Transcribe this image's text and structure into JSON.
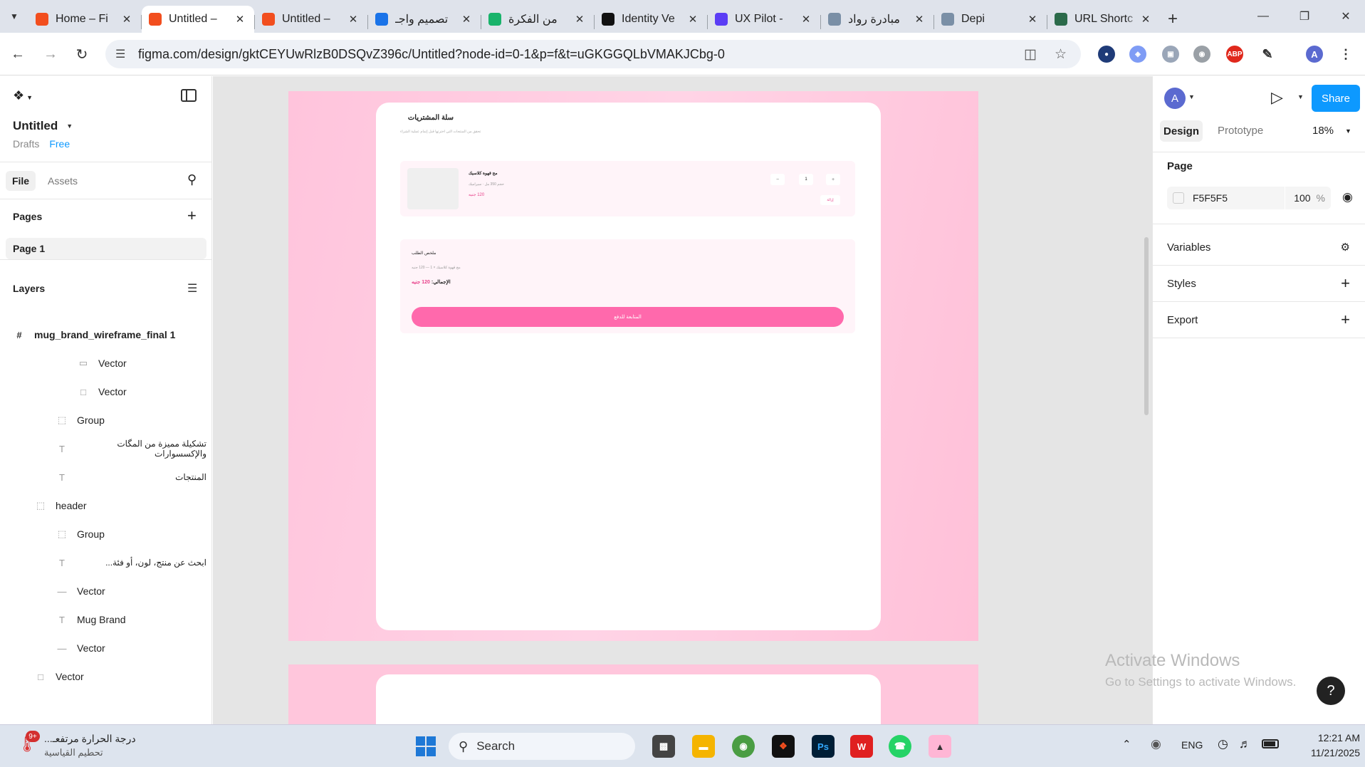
{
  "browser": {
    "tabs": [
      {
        "title": "Home – Fi",
        "favicon": "figma-icon",
        "color": "#f24e1e"
      },
      {
        "title": "Untitled –",
        "favicon": "figma-icon",
        "color": "#f24e1e",
        "active": true
      },
      {
        "title": "Untitled –",
        "favicon": "figma-icon",
        "color": "#f24e1e"
      },
      {
        "title": "تصميم واجـ",
        "favicon": "swirl-icon",
        "color": "#1a73e8"
      },
      {
        "title": "من الفكرة",
        "favicon": "k-logo-icon",
        "color": "#19b36b"
      },
      {
        "title": "Identity Ve",
        "favicon": "upwork-icon",
        "color": "#111111"
      },
      {
        "title": "UX Pilot - ",
        "favicon": "ux-logo-icon",
        "color": "#5b3df5"
      },
      {
        "title": "مبادرة رواد",
        "favicon": "person-icon",
        "color": "#7a8fa6"
      },
      {
        "title": "Depi",
        "favicon": "person-icon",
        "color": "#7a8fa6"
      },
      {
        "title": "URL Shortc",
        "favicon": "link-icon",
        "color": "#2b6a4a"
      }
    ],
    "url": "figma.com/design/gktCEYUwRlzB0DSQvZ396c/Untitled?node-id=0-1&p=f&t=uGKGGQLbVMAKJCbg-0",
    "profile_initial": "A"
  },
  "figma": {
    "file_name": "Untitled",
    "location": "Drafts",
    "plan": "Free",
    "left_tabs": {
      "file": "File",
      "assets": "Assets"
    },
    "pages_label": "Pages",
    "pages": [
      "Page 1"
    ],
    "layers_label": "Layers",
    "layers": [
      {
        "name": "mug_brand_wireframe_final 1",
        "icon": "frame-icon",
        "indent": 0,
        "bold": true
      },
      {
        "name": "Vector",
        "icon": "rectangle-icon",
        "indent": 3
      },
      {
        "name": "Vector",
        "icon": "square-icon",
        "indent": 3
      },
      {
        "name": "Group",
        "icon": "group-icon",
        "indent": 2
      },
      {
        "name": "تشكيلة مميزة من المگات والإكسسوارات",
        "icon": "text-icon",
        "indent": 2
      },
      {
        "name": "المنتجات",
        "icon": "text-icon",
        "indent": 2
      },
      {
        "name": "header",
        "icon": "group-icon",
        "indent": 1
      },
      {
        "name": "Group",
        "icon": "group-icon",
        "indent": 2
      },
      {
        "name": "ابحث عن منتج، لون، أو فئة...",
        "icon": "text-icon",
        "indent": 2
      },
      {
        "name": "Vector",
        "icon": "line-icon",
        "indent": 2
      },
      {
        "name": "Mug Brand",
        "icon": "text-icon",
        "indent": 2
      },
      {
        "name": "Vector",
        "icon": "line-icon",
        "indent": 2
      },
      {
        "name": "Vector",
        "icon": "square-icon",
        "indent": 1
      }
    ],
    "right": {
      "avatar": "A",
      "share": "Share",
      "tabs": {
        "design": "Design",
        "prototype": "Prototype"
      },
      "zoom": "18%",
      "page_label": "Page",
      "page_color": "F5F5F5",
      "page_opacity": "100",
      "percent": "%",
      "variables": "Variables",
      "styles": "Styles",
      "export": "Export"
    },
    "design": {
      "cart_title": "سلة المشتريات",
      "cart_subtitle": "تحقق من المنتجات التي اخترتها قبل إتمام عملية الشراء",
      "item_name": "مج قهوة كلاسيك",
      "item_meta": "حجم 350 مل · سيراميك",
      "item_price": "120 جنيه",
      "qty_minus": "−",
      "qty_value": "1",
      "qty_plus": "+",
      "remove": "إزالة",
      "summary_title": "ملخص الطلب",
      "summary_line": "مج قهوة كلاسيك × 1 — 120 جنيه",
      "total_label": "الإجمالي:",
      "total_value": "120 جنيه",
      "checkout": "المتابعة للدفع"
    }
  },
  "watermark": {
    "line1": "Activate Windows",
    "line2": "Go to Settings to activate Windows."
  },
  "taskbar": {
    "weather_line1": "درجة الحرارة مرتفعـ...",
    "weather_line2": "تحطيم القياسية",
    "weather_badge": "9+",
    "search": "Search",
    "lang": "ENG",
    "time": "12:21 AM",
    "date": "11/21/2025"
  }
}
